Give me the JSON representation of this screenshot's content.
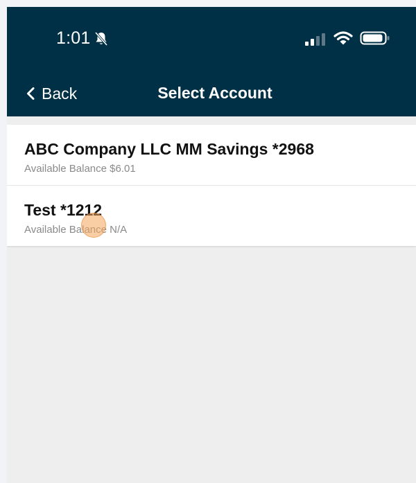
{
  "status_bar": {
    "time": "1:01",
    "icons": [
      "bell-slash-icon",
      "cellular-signal-icon",
      "wifi-icon",
      "battery-icon"
    ]
  },
  "nav": {
    "back_label": "Back",
    "title": "Select Account"
  },
  "accounts": [
    {
      "name": "ABC Company LLC MM Savings *2968",
      "balance": "Available Balance $6.01"
    },
    {
      "name": "Test *1212",
      "balance": "Available Balance N/A"
    }
  ],
  "colors": {
    "header_bg": "#003045",
    "page_bg": "#eeeeee",
    "list_bg": "#ffffff",
    "touch_indicator": "#f5a65a"
  }
}
